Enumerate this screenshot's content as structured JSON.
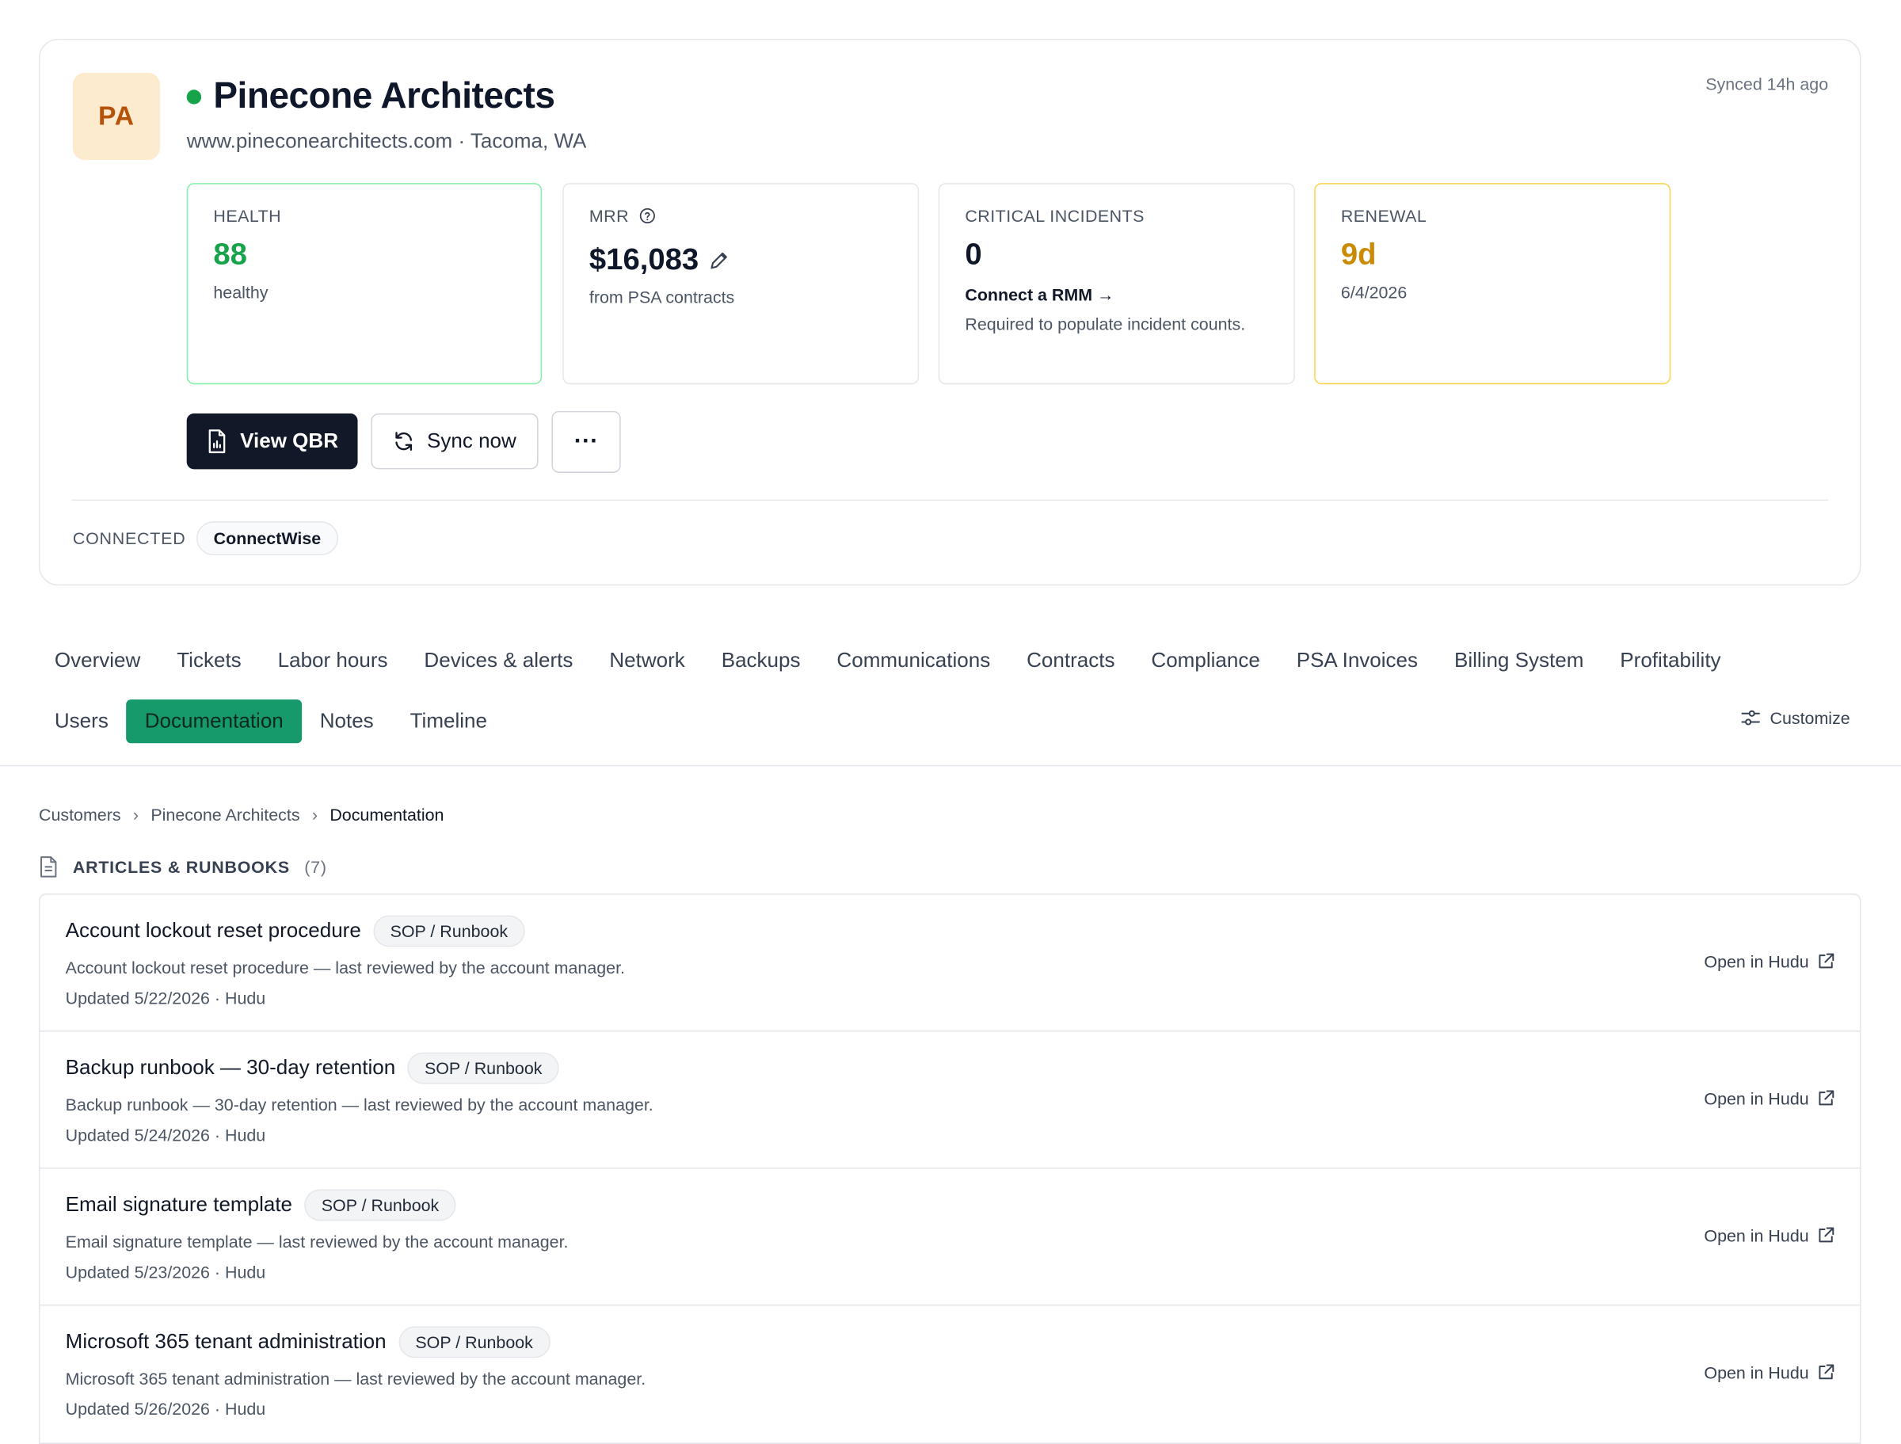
{
  "company": {
    "initials": "PA",
    "name": "Pinecone Architects",
    "subline": "www.pineconearchitects.com · Tacoma, WA",
    "synced": "Synced 14h ago"
  },
  "stats": {
    "health": {
      "label": "HEALTH",
      "value": "88",
      "sub": "healthy"
    },
    "mrr": {
      "label": "MRR",
      "value": "$16,083",
      "sub": "from PSA contracts"
    },
    "incidents": {
      "label": "CRITICAL INCIDENTS",
      "value": "0",
      "link": "Connect a RMM →",
      "sub": "Required to populate incident counts."
    },
    "renewal": {
      "label": "RENEWAL",
      "value": "9d",
      "sub": "6/4/2026"
    }
  },
  "actions": {
    "view_qbr": "View QBR",
    "sync_now": "Sync now",
    "more": "···"
  },
  "connected": {
    "label": "CONNECTED",
    "chips": [
      "ConnectWise"
    ]
  },
  "tabs": {
    "row1": [
      "Overview",
      "Tickets",
      "Labor hours",
      "Devices & alerts",
      "Network",
      "Backups",
      "Communications",
      "Contracts",
      "Compliance",
      "PSA Invoices",
      "Billing System",
      "Profitability"
    ],
    "row2": [
      "Users",
      "Documentation",
      "Notes",
      "Timeline"
    ],
    "active": "Documentation",
    "customize": "Customize"
  },
  "breadcrumb": [
    "Customers",
    "Pinecone Architects",
    "Documentation"
  ],
  "section": {
    "title": "ARTICLES & RUNBOOKS",
    "count": "(7)"
  },
  "articles": [
    {
      "title": "Account lockout reset procedure",
      "tag": "SOP / Runbook",
      "desc": "Account lockout reset procedure — last reviewed by the account manager.",
      "meta": "Updated 5/22/2026 · Hudu",
      "link": "Open in Hudu"
    },
    {
      "title": "Backup runbook — 30-day retention",
      "tag": "SOP / Runbook",
      "desc": "Backup runbook — 30-day retention — last reviewed by the account manager.",
      "meta": "Updated 5/24/2026 · Hudu",
      "link": "Open in Hudu"
    },
    {
      "title": "Email signature template",
      "tag": "SOP / Runbook",
      "desc": "Email signature template — last reviewed by the account manager.",
      "meta": "Updated 5/23/2026 · Hudu",
      "link": "Open in Hudu"
    },
    {
      "title": "Microsoft 365 tenant administration",
      "tag": "SOP / Runbook",
      "desc": "Microsoft 365 tenant administration — last reviewed by the account manager.",
      "meta": "Updated 5/26/2026 · Hudu",
      "link": "Open in Hudu"
    }
  ],
  "colors": {
    "accent_green": "#16a34a",
    "active_tab": "#16996b",
    "amber": "#ca8a04",
    "dark_button": "#111827"
  }
}
